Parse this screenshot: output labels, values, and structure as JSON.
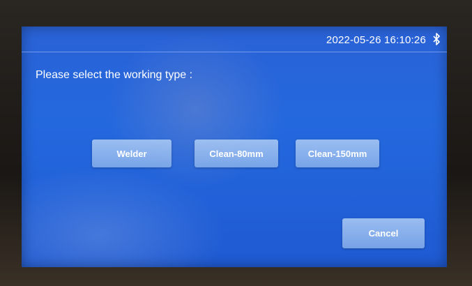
{
  "status_bar": {
    "datetime": "2022-05-26 16:10:26",
    "icon": "bluetooth-icon"
  },
  "prompt": "Please select the working type :",
  "options": [
    {
      "label": "Welder"
    },
    {
      "label": "Clean-80mm"
    },
    {
      "label": "Clean-150mm"
    }
  ],
  "cancel_label": "Cancel",
  "colors": {
    "screen_blue": "#2468de",
    "button_fill": "#a9c9f2",
    "text": "#ffffff"
  }
}
